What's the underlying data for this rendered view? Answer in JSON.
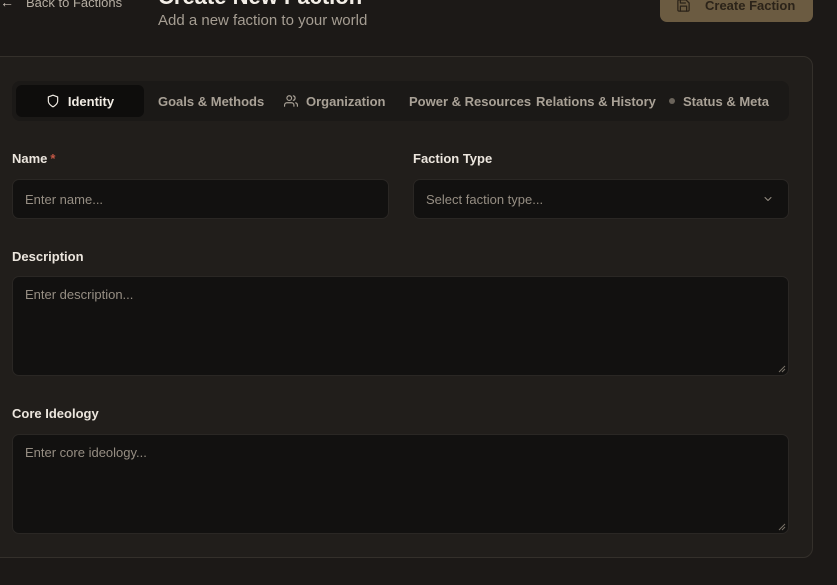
{
  "header": {
    "back_label": "Back to Factions",
    "title": "Create New Faction",
    "subtitle": "Add a new faction to your world",
    "create_label": "Create Faction"
  },
  "tabs": [
    {
      "label": "Identity",
      "icon": "shield-icon",
      "active": true
    },
    {
      "label": "Goals & Methods",
      "icon": null
    },
    {
      "label": "Organization",
      "icon": "users-icon"
    },
    {
      "label": "Power & Resources",
      "icon": null
    },
    {
      "label": "Relations & History",
      "icon": null
    },
    {
      "label": "Status & Meta",
      "icon": "dot-icon"
    }
  ],
  "form": {
    "name": {
      "label": "Name",
      "required_mark": "*",
      "placeholder": "Enter name..."
    },
    "faction_type": {
      "label": "Faction Type",
      "placeholder": "Select faction type..."
    },
    "description": {
      "label": "Description",
      "placeholder": "Enter description..."
    },
    "core_ideology": {
      "label": "Core Ideology",
      "placeholder": "Enter core ideology..."
    }
  },
  "colors": {
    "background": "#1c1917",
    "card": "#211e1b",
    "accent_button": "#6b5b41",
    "required": "#c25745"
  }
}
